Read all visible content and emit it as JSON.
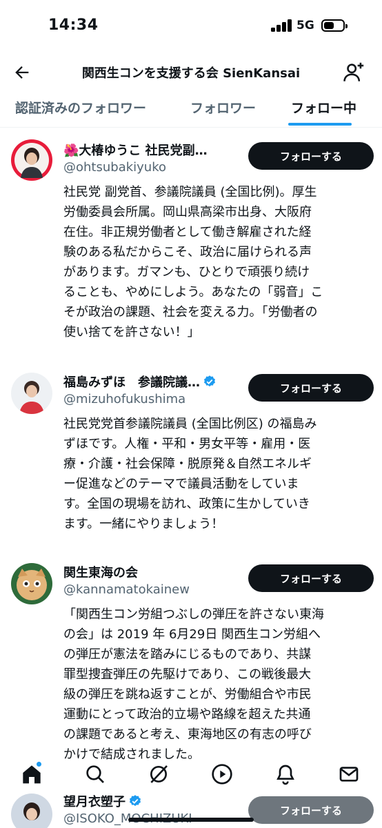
{
  "status_bar": {
    "time": "14:34",
    "network": "5G"
  },
  "header": {
    "title": "関西生コンを支援する会 SienKansai"
  },
  "tabs": [
    {
      "label": "認証済みのフォロワー",
      "active": false
    },
    {
      "label": "フォロワー",
      "active": false
    },
    {
      "label": "フォロー中",
      "active": true
    }
  ],
  "users": [
    {
      "name": "🌺大椿ゆうこ 社民党副…",
      "handle": "@ohtsubakiyuko",
      "verified": false,
      "button_label": "フォローする",
      "bio_lines": [
        "社民党 副党首、参議院議員 (全国比例)。厚生",
        "労働委員会所属。岡山県高梁市出身、大阪府",
        "在住。非正規労働者として働き解雇された経",
        "験のある私だからこそ、政治に届けられる声",
        "があります。ガマンも、ひとりで頑張り続け",
        "ることも、やめにしよう。あなたの「弱音」こ",
        "そが政治の課題、社会を変える力。「労働者の",
        "使い捨てを許さない！」"
      ]
    },
    {
      "name": "福島みずほ　参議院議…",
      "handle": "@mizuhofukushima",
      "verified": true,
      "button_label": "フォローする",
      "bio_lines": [
        "社民党党首参議院議員 (全国比例区) の福島み",
        "ずほです。人権・平和・男女平等・雇用・医",
        "療・介護・社会保障・脱原発＆自然エネルギ",
        "ー促進などのテーマで議員活動をしていま",
        "す。全国の現場を訪れ、政策に生かしていき",
        "ます。一緒にやりましょう！"
      ]
    },
    {
      "name": "関生東海の会",
      "handle": "@kannamatokainew",
      "verified": false,
      "button_label": "フォローする",
      "bio_lines": [
        "「関西生コン労組つぶしの弾圧を許さない東海",
        "の会」は 2019 年 6月29日 関西生コン労組へ",
        "の弾圧が憲法を踏みにじるものであり、共謀",
        "罪型捜査弾圧の先駆けであり、この戦後最大",
        "級の弾圧を跳ね返すことが、労働組合や市民",
        "運動にとって政治的立場や路線を超えた共通",
        "の課題であると考え、東海地区の有志の呼び",
        "かけで結成されました。"
      ]
    },
    {
      "name": "望月衣塑子",
      "handle": "@ISOKO_MOCHIZUKI",
      "verified": true,
      "button_label": "フォローする",
      "bio_lines": []
    }
  ],
  "bottom_nav": [
    "home-icon",
    "search-icon",
    "grok-icon",
    "video-icon",
    "notifications-icon",
    "messages-icon"
  ],
  "colors": {
    "accent": "#1d9bf0",
    "text": "#0f1419",
    "secondary": "#536471",
    "button": "#0f1419"
  }
}
